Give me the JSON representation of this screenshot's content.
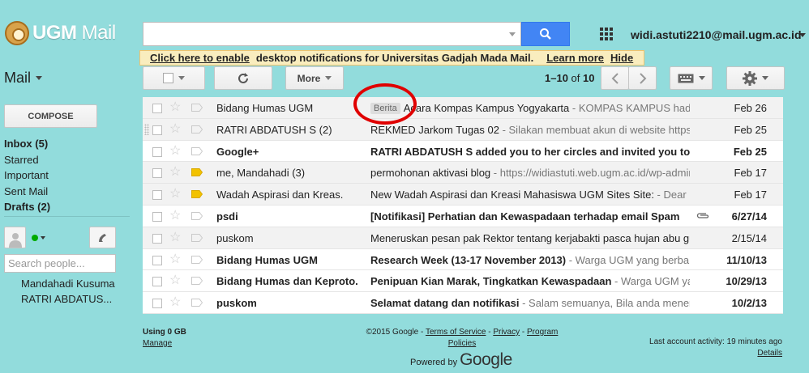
{
  "header": {
    "logo_text_bold": "UGM",
    "logo_text_light": "Mail",
    "search": {
      "value": "",
      "placeholder": ""
    },
    "account": "widi.astuti2210@mail.ugm.ac.id"
  },
  "notification": {
    "link_enable": "Click here to enable",
    "message": "desktop notifications for Universitas Gadjah Mada Mail.",
    "learn_more": "Learn more",
    "hide": "Hide"
  },
  "toolbar": {
    "mail_label": "Mail",
    "more_label": "More",
    "pager_range": "1–10",
    "pager_of": "of",
    "pager_total": "10"
  },
  "sidebar": {
    "compose_label": "COMPOSE",
    "items": [
      {
        "label": "Inbox (5)",
        "bold": true
      },
      {
        "label": "Starred",
        "bold": false
      },
      {
        "label": "Important",
        "bold": false
      },
      {
        "label": "Sent Mail",
        "bold": false
      },
      {
        "label": "Drafts (2)",
        "bold": true
      }
    ],
    "people_search_placeholder": "Search people...",
    "contacts": [
      "Mandahadi Kusuma",
      "RATRI ABDATUS..."
    ]
  },
  "messages": [
    {
      "sender": "Bidang Humas UGM",
      "label": "Berita",
      "subject": "Acara Kompas Kampus Yogyakarta",
      "snippet": " - KOMPAS KAMPUS hadir",
      "date": "Feb 26",
      "unread": false,
      "important": false,
      "attachment": false
    },
    {
      "sender": "RATRI ABDATUSH S (2)",
      "label": "",
      "subject": "REKMED Jarkom Tugas 02",
      "snippet": " - Silakan membuat akun di website https://",
      "date": "Feb 25",
      "unread": false,
      "important": false,
      "attachment": false
    },
    {
      "sender": "Google+",
      "label": "",
      "subject": "RATRI ABDATUSH S added you to her circles and invited you to join",
      "snippet": "",
      "date": "Feb 25",
      "unread": true,
      "important": false,
      "attachment": false
    },
    {
      "sender": "me, Mandahadi (3)",
      "label": "",
      "subject": "permohonan aktivasi blog",
      "snippet": " - https://widiastuti.web.ugm.ac.id/wp-admin",
      "date": "Feb 17",
      "unread": false,
      "important": true,
      "attachment": false
    },
    {
      "sender": "Wadah Aspirasi dan Kreas.",
      "label": "",
      "subject": "New Wadah Aspirasi dan Kreasi Mahasiswa UGM Sites Site:",
      "snippet": " - Dear",
      "date": "Feb 17",
      "unread": false,
      "important": true,
      "attachment": false
    },
    {
      "sender": "psdi",
      "label": "",
      "subject": "[Notifikasi] Perhatian dan Kewaspadaan terhadap email Spam",
      "snippet": "",
      "date": "6/27/14",
      "unread": true,
      "important": false,
      "attachment": true
    },
    {
      "sender": "puskom",
      "label": "",
      "subject": "Meneruskan pesan pak Rektor tentang kerjabakti pasca hujan abu gunung",
      "snippet": "",
      "date": "2/15/14",
      "unread": false,
      "important": false,
      "attachment": false
    },
    {
      "sender": "Bidang Humas UGM",
      "label": "",
      "subject": "Research Week (13-17 November 2013)",
      "snippet": " - Warga UGM yang berbahagia",
      "date": "11/10/13",
      "unread": true,
      "important": false,
      "attachment": false
    },
    {
      "sender": "Bidang Humas dan Keproto.",
      "label": "",
      "subject": "Penipuan Kian Marak, Tingkatkan Kewaspadaan",
      "snippet": " - Warga UGM yang",
      "date": "10/29/13",
      "unread": true,
      "important": false,
      "attachment": false
    },
    {
      "sender": "puskom",
      "label": "",
      "subject": "Selamat datang dan notifikasi",
      "snippet": " - Salam semuanya, Bila anda menerima",
      "date": "10/2/13",
      "unread": true,
      "important": false,
      "attachment": false
    }
  ],
  "footer": {
    "usage": "Using 0 GB",
    "manage": "Manage",
    "copyright": "©2015 Google -",
    "terms": "Terms of Service",
    "privacy": "Privacy",
    "program": "Program",
    "policies": "Policies",
    "powered_by": "Powered by",
    "google": "Google",
    "last_activity": "Last account activity: 19 minutes ago",
    "details": "Details"
  },
  "colors": {
    "background": "#92dcdc",
    "search_button": "#4285f4",
    "notification_bg": "#f9edbe",
    "annotation_circle": "#e00000",
    "important_marker": "#f2c200"
  }
}
